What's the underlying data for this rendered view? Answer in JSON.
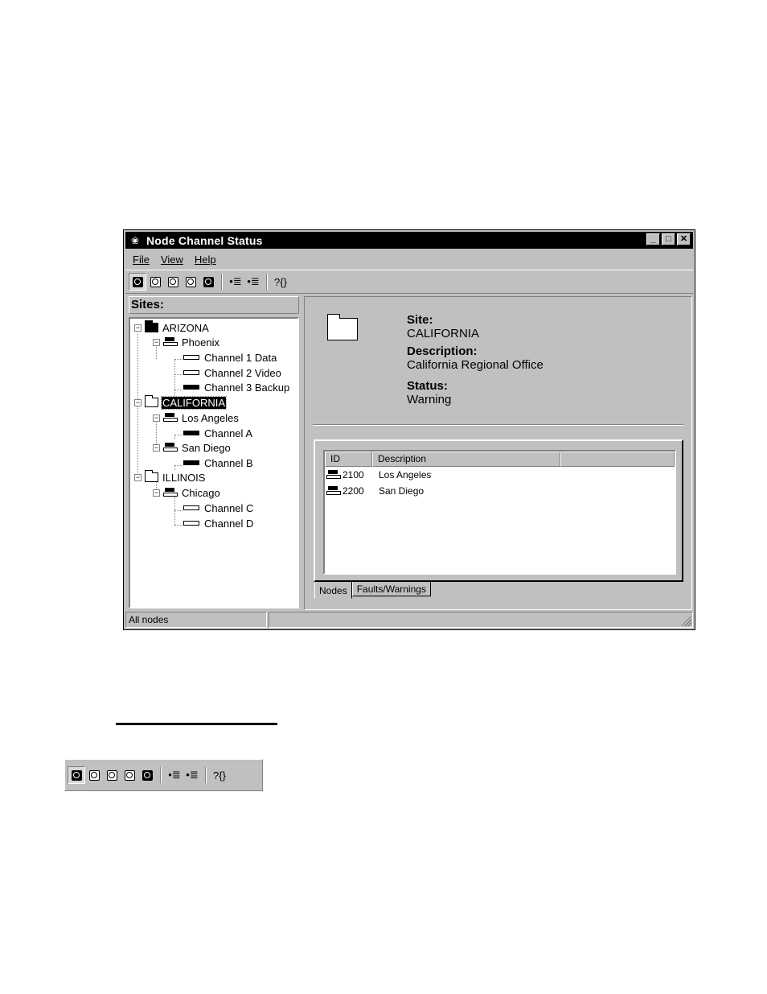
{
  "window": {
    "title": "Node Channel Status"
  },
  "menu": {
    "file": "File",
    "view": "View",
    "help": "Help"
  },
  "toolbar": {
    "buttons": [
      {
        "icon": "view-all-nodes-icon",
        "pressed": true
      },
      {
        "icon": "zoom-icon"
      },
      {
        "icon": "zoom-icon"
      },
      {
        "icon": "zoom-icon"
      },
      {
        "icon": "view-nodes-icon"
      },
      {
        "icon": "expand-icon",
        "glyph": "•≣"
      },
      {
        "icon": "collapse-icon",
        "glyph": "•≣"
      },
      {
        "icon": "help-icon",
        "glyph": "?{}"
      }
    ]
  },
  "sites": {
    "header": "Sites:",
    "tree": {
      "arizona": "ARIZONA",
      "phoenix": "Phoenix",
      "ch1": "Channel 1 Data",
      "ch2": "Channel 2 Video",
      "ch3": "Channel 3 Backup",
      "california": "CALIFORNIA",
      "los_angeles": "Los Angeles",
      "chA": "Channel A",
      "san_diego": "San Diego",
      "chB": "Channel B",
      "illinois": "ILLINOIS",
      "chicago": "Chicago",
      "chC": "Channel C",
      "chD": "Channel D"
    }
  },
  "detail": {
    "site_label": "Site:",
    "site_value": "CALIFORNIA",
    "desc_label": "Description:",
    "desc_value": "California Regional Office",
    "status_label": "Status:",
    "status_value": "Warning"
  },
  "list": {
    "col_id": "ID",
    "col_desc": "Description",
    "rows": [
      {
        "id": "2100",
        "desc": "Los Angeles"
      },
      {
        "id": "2200",
        "desc": "San Diego"
      }
    ]
  },
  "tabs": {
    "nodes": "Nodes",
    "faults": "Faults/Warnings"
  },
  "status": {
    "text": "All nodes"
  }
}
